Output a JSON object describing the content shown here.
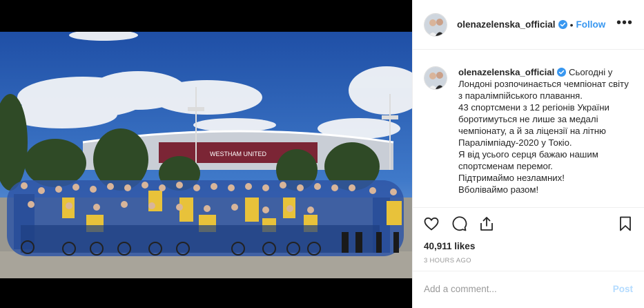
{
  "post": {
    "photo_sign_text": "WESTHAM UNITED",
    "colors": {
      "sky": "#2d63b8",
      "jacket_blue": "#2f56a6",
      "jacket_yellow": "#e8c23a",
      "link": "#3897f0"
    }
  },
  "header": {
    "username": "olenazelenska_official",
    "dot": "•",
    "follow_label": "Follow",
    "more_label": "•••",
    "verified_icon": "verified-badge-icon"
  },
  "caption": {
    "username": "olenazelenska_official",
    "text": "Сьогодні у Лондоні розпочинається чемпіонат світу з паралімпійського плавання.\n43 спортсмени з 12 регіонів України боротимуться не лише за медалі чемпіонату, а й за ліцензії на літню Паралімпіаду-2020 у Токіо.\nЯ від усього серця бажаю нашим спортсменам перемог.\nПідтримаймо незламних!\nВболіваймо разом!"
  },
  "actions": {
    "like_icon": "heart-icon",
    "comment_icon": "comment-icon",
    "share_icon": "share-icon",
    "save_icon": "bookmark-icon"
  },
  "likes": "40,911 likes",
  "time": "3 HOURS AGO",
  "comment_box": {
    "placeholder": "Add a comment...",
    "post_label": "Post"
  }
}
